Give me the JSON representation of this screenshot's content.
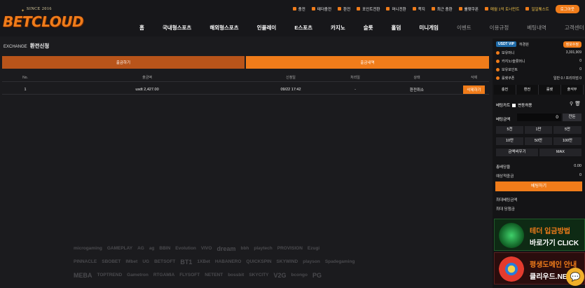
{
  "brand": {
    "since": "SINCE 2016",
    "name": "BETCLOUD"
  },
  "topbar": [
    {
      "label": "충전",
      "icon": "deposit-icon"
    },
    {
      "label": "테더충전",
      "icon": "tether-icon"
    },
    {
      "label": "환전",
      "icon": "exchange-icon"
    },
    {
      "label": "포인트전환",
      "icon": "point-icon"
    },
    {
      "label": "머니전환",
      "icon": "money-icon"
    },
    {
      "label": "쪽지",
      "icon": "message-icon"
    },
    {
      "label": "최근 충환",
      "icon": "history-icon"
    },
    {
      "label": "룰렛쿠폰",
      "icon": "roulette-icon"
    },
    {
      "label": "매월 1억 토너먼트",
      "icon": "trophy-icon",
      "gold": true
    },
    {
      "label": "일일퀘스트",
      "icon": "quest-icon",
      "gold": true
    }
  ],
  "login_label": "로그아웃",
  "nav": [
    {
      "label": "홈",
      "dim": false
    },
    {
      "label": "국내형스포츠",
      "dim": false
    },
    {
      "label": "해외형스포츠",
      "dim": false
    },
    {
      "label": "인플레이",
      "dim": false
    },
    {
      "label": "E스포츠",
      "dim": false
    },
    {
      "label": "카지노",
      "dim": false
    },
    {
      "label": "슬롯",
      "dim": false
    },
    {
      "label": "홀덤",
      "dim": false
    },
    {
      "label": "미니게임",
      "dim": false
    },
    {
      "label": "이벤트",
      "dim": true
    },
    {
      "label": "이용규정",
      "dim": true
    },
    {
      "label": "베팅내역",
      "dim": true
    },
    {
      "label": "고객센터",
      "dim": true
    }
  ],
  "page": {
    "section": "EXCHANGE",
    "title": "환전신청",
    "tab_request": "출금하기",
    "tab_history": "출금내역"
  },
  "table": {
    "headers": [
      "No.",
      "출금액",
      "신청일",
      "처리일",
      "상태",
      "삭제"
    ],
    "rows": [
      {
        "no": "1",
        "amount": "usdt 2,427.00",
        "requested": "09/22 17:42",
        "processed": "-",
        "status": "환전취소",
        "action": "삭제하기"
      }
    ]
  },
  "partners": [
    [
      "microgaming",
      "GAMEPLAY",
      "AG",
      "ag",
      "BBIN",
      "Evolution",
      "VIVO",
      "dream",
      "bbh",
      "playtech",
      "PROVISION",
      "Ezugi"
    ],
    [
      "PINNACLE",
      "SBOBET",
      "IMbet",
      "UG",
      "BETSOFT",
      "BT1",
      "1XBet",
      "HABANERO",
      "QUICKSPIN",
      "SKYWIND",
      "playson",
      "Spadegaming"
    ],
    [
      "MEBA",
      "TOPTREND",
      "Gametron",
      "RTGAMIA",
      "FLYSOFT",
      "NETENT",
      "bossbit",
      "SKYCITY",
      "V2G",
      "bcongo",
      "PG"
    ]
  ],
  "sidebar": {
    "badge": "USDT VIP",
    "user": "하경원",
    "info_btn": "정보수정",
    "balances": [
      {
        "label": "보유머니",
        "value": "3,301,909"
      },
      {
        "label": "카지노/슬롯머니",
        "value": "0"
      },
      {
        "label": "보유포인트",
        "value": "0"
      },
      {
        "label": "룰렛쿠폰",
        "value": "일반 0 / 프리미엄 0"
      }
    ],
    "quick": [
      "충전",
      "환전",
      "룰렛",
      "출석부"
    ],
    "betcart": "베팅카트",
    "fix": "변동허용",
    "amount_label": "베팅금액",
    "amount_value": "0",
    "reset": "잔돈",
    "chips": [
      "5천",
      "1만",
      "5만",
      "10만",
      "50만",
      "100만"
    ],
    "clear": "금액비우기",
    "max": "MAX",
    "odds_label": "총배당율",
    "odds_value": "0.00",
    "win_label": "예상적중금",
    "win_value": "0",
    "bet_btn": "베팅하기",
    "max_bet": "최대베팅금액",
    "max_win": "최대 당첨금",
    "banners": [
      {
        "title": "테더 입금방법",
        "cta": "바로가기 CLICK"
      },
      {
        "title": "평생도메인 안내",
        "cta": "클리우드.NET"
      }
    ]
  }
}
